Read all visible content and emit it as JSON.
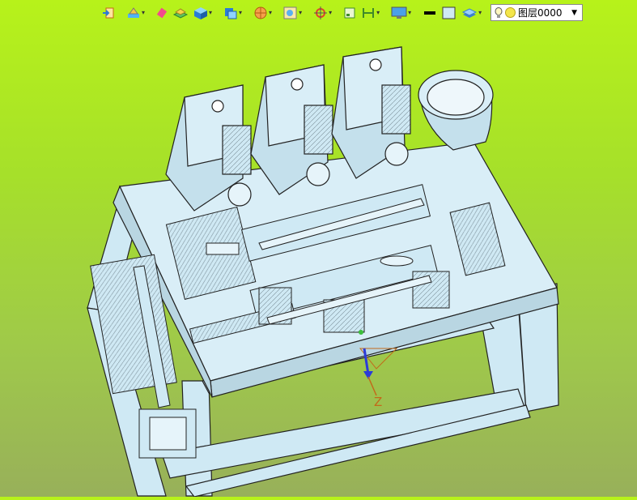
{
  "toolbar": {
    "icons": [
      {
        "name": "exit-sketch-icon",
        "has_dropdown": false
      },
      {
        "name": "fill-bucket-icon",
        "has_dropdown": true
      },
      {
        "name": "eraser-icon",
        "has_dropdown": false
      },
      {
        "name": "layers-stack-icon",
        "has_dropdown": false
      },
      {
        "name": "cube-icon",
        "has_dropdown": true
      },
      {
        "name": "view-orient-icon",
        "has_dropdown": true
      },
      {
        "name": "render-sphere-icon",
        "has_dropdown": true
      },
      {
        "name": "zoom-box-icon",
        "has_dropdown": true
      },
      {
        "name": "pan-target-icon",
        "has_dropdown": true
      },
      {
        "name": "select-box-icon",
        "has_dropdown": false
      },
      {
        "name": "dimension-icon",
        "has_dropdown": true
      },
      {
        "name": "monitor-icon",
        "has_dropdown": true
      },
      {
        "name": "line-style-icon",
        "has_dropdown": false
      },
      {
        "name": "color-swatch-icon",
        "has_dropdown": false
      },
      {
        "name": "layer-manager-icon",
        "has_dropdown": true
      }
    ],
    "layer_combo": {
      "value": "图层0000"
    }
  },
  "viewport": {
    "axis_label": "Z",
    "background_top": "#b7f21a",
    "background_bottom": "#98b05a",
    "model_fill": "#cfe9f4",
    "model_stroke": "#2a2a2a"
  }
}
